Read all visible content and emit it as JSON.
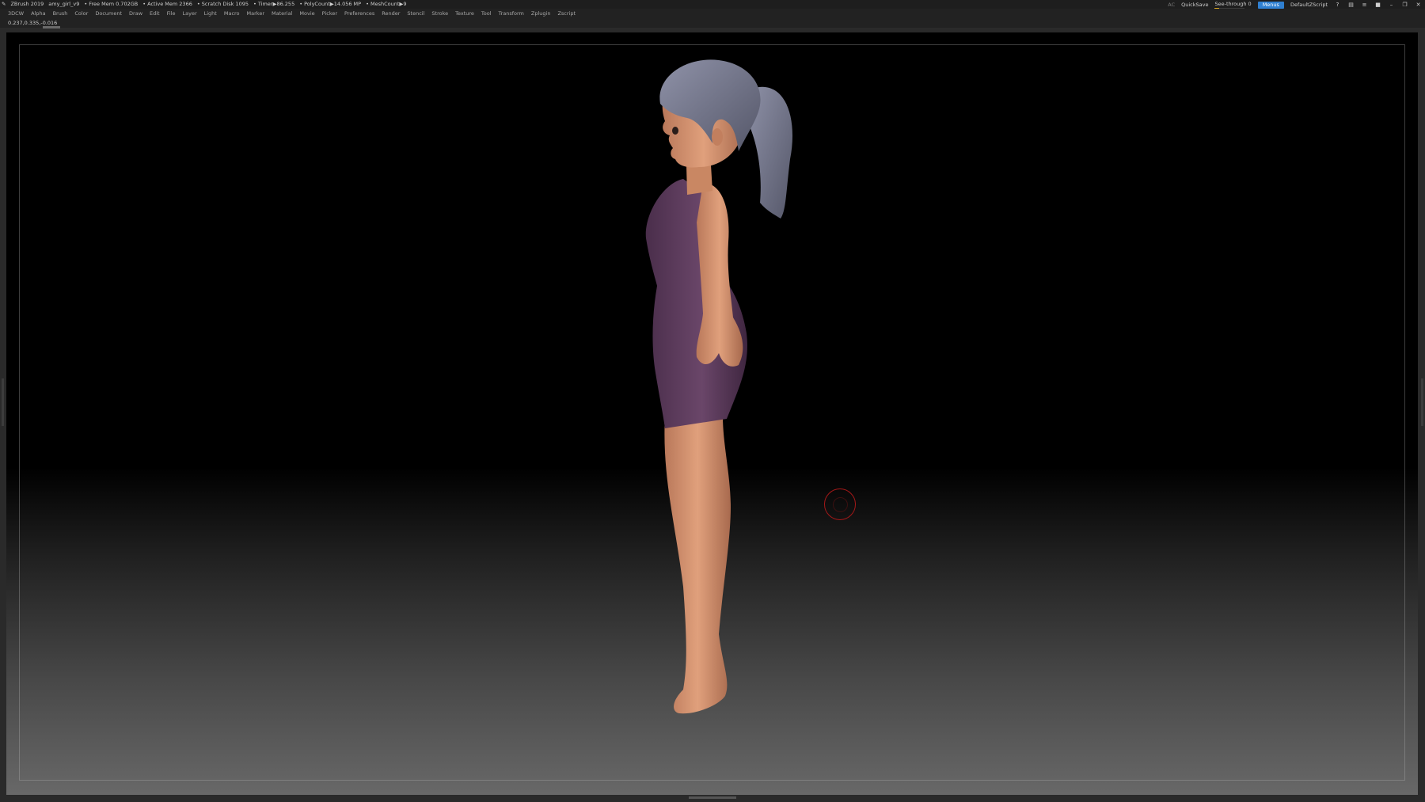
{
  "titlebar": {
    "app_name": "ZBrush 2019",
    "file_name": "amy_girl_v9",
    "free_mem": "• Free Mem 0.702GB",
    "active_mem": "• Active Mem 2366",
    "scratch_disk": "• Scratch Disk 1095",
    "timer": "• Timer▶86.255",
    "poly_count": "• PolyCount▶14.056 MP",
    "mesh_count": "• MeshCount▶9",
    "ac_label": "AC",
    "quicksave_label": "QuickSave",
    "see_through_label": "See-through  0",
    "see_through_value": 0.15,
    "menus_button_label": "Menus",
    "default_script_label": "DefaultZScript"
  },
  "menubar": {
    "items": [
      "3DCW",
      "Alpha",
      "Brush",
      "Color",
      "Document",
      "Draw",
      "Edit",
      "File",
      "Layer",
      "Light",
      "Macro",
      "Marker",
      "Material",
      "Movie",
      "Picker",
      "Preferences",
      "Render",
      "Stencil",
      "Stroke",
      "Texture",
      "Tool",
      "Transform",
      "Zplugin",
      "Zscript"
    ]
  },
  "infobar": {
    "coordinates": "0.237,0.335,-0.016"
  },
  "colors": {
    "dress": "#5d3d5e",
    "skin": "#d9956e",
    "hair": "#7c7e93",
    "brush_cursor": "#a41818",
    "menu_accent": "#2f7fd0"
  }
}
